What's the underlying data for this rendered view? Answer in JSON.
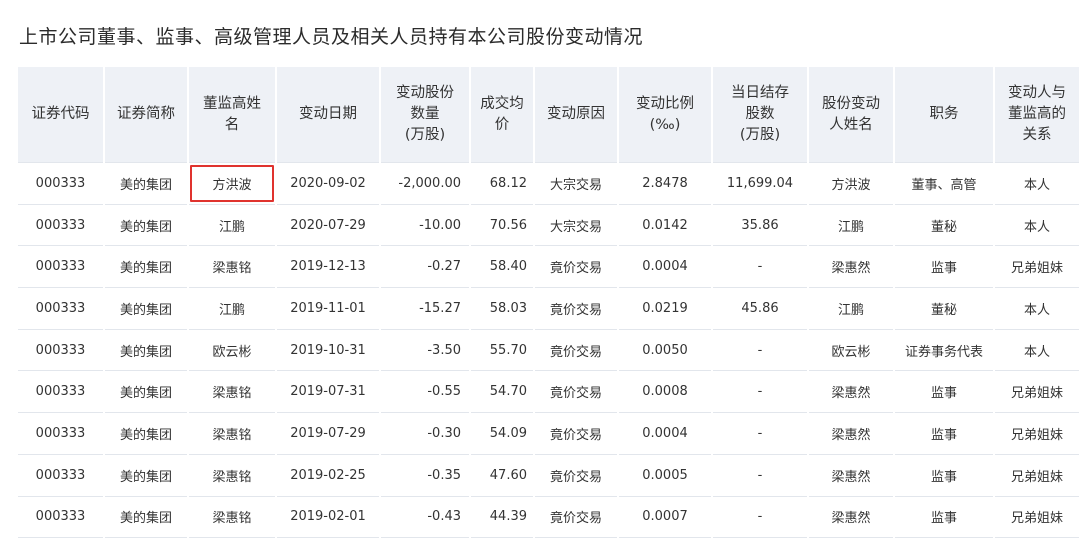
{
  "title": "上市公司董事、监事、高级管理人员及相关人员持有本公司股份变动情况",
  "headers": [
    "证券代码",
    "证券简称",
    "董监高姓名",
    "变动日期",
    "变动股份数量(万股)",
    "成交均价",
    "变动原因",
    "变动比例(‰)",
    "当日结存股数(万股)",
    "股份变动人姓名",
    "职务",
    "变动人与董监高的关系"
  ],
  "header_display": [
    "证券代码",
    "证券简称",
    "董监高姓\n名",
    "变动日期",
    "变动股份\n数量\n(万股)",
    "成交均\n价",
    "变动原因",
    "变动比例\n(‰)",
    "当日结存\n股数\n(万股)",
    "股份变动\n人姓名",
    "职务",
    "变动人与\n董监高的\n关系"
  ],
  "rows": [
    [
      "000333",
      "美的集团",
      "方洪波",
      "2020-09-02",
      "-2,000.00",
      "68.12",
      "大宗交易",
      "2.8478",
      "11,699.04",
      "方洪波",
      "董事、高管",
      "本人"
    ],
    [
      "000333",
      "美的集团",
      "江鹏",
      "2020-07-29",
      "-10.00",
      "70.56",
      "大宗交易",
      "0.0142",
      "35.86",
      "江鹏",
      "董秘",
      "本人"
    ],
    [
      "000333",
      "美的集团",
      "梁惠铭",
      "2019-12-13",
      "-0.27",
      "58.40",
      "竟价交易",
      "0.0004",
      "-",
      "梁惠然",
      "监事",
      "兄弟姐妹"
    ],
    [
      "000333",
      "美的集团",
      "江鹏",
      "2019-11-01",
      "-15.27",
      "58.03",
      "竟价交易",
      "0.0219",
      "45.86",
      "江鹏",
      "董秘",
      "本人"
    ],
    [
      "000333",
      "美的集团",
      "欧云彬",
      "2019-10-31",
      "-3.50",
      "55.70",
      "竟价交易",
      "0.0050",
      "-",
      "欧云彬",
      "证券事务代表",
      "本人"
    ],
    [
      "000333",
      "美的集团",
      "梁惠铭",
      "2019-07-31",
      "-0.55",
      "54.70",
      "竟价交易",
      "0.0008",
      "-",
      "梁惠然",
      "监事",
      "兄弟姐妹"
    ],
    [
      "000333",
      "美的集团",
      "梁惠铭",
      "2019-07-29",
      "-0.30",
      "54.09",
      "竟价交易",
      "0.0004",
      "-",
      "梁惠然",
      "监事",
      "兄弟姐妹"
    ],
    [
      "000333",
      "美的集团",
      "梁惠铭",
      "2019-02-25",
      "-0.35",
      "47.60",
      "竟价交易",
      "0.0005",
      "-",
      "梁惠然",
      "监事",
      "兄弟姐妹"
    ],
    [
      "000333",
      "美的集团",
      "梁惠铭",
      "2019-02-01",
      "-0.43",
      "44.39",
      "竟价交易",
      "0.0007",
      "-",
      "梁惠然",
      "监事",
      "兄弟姐妹"
    ]
  ],
  "highlight": {
    "row": 0,
    "col": 2,
    "color": "#e0332e"
  }
}
